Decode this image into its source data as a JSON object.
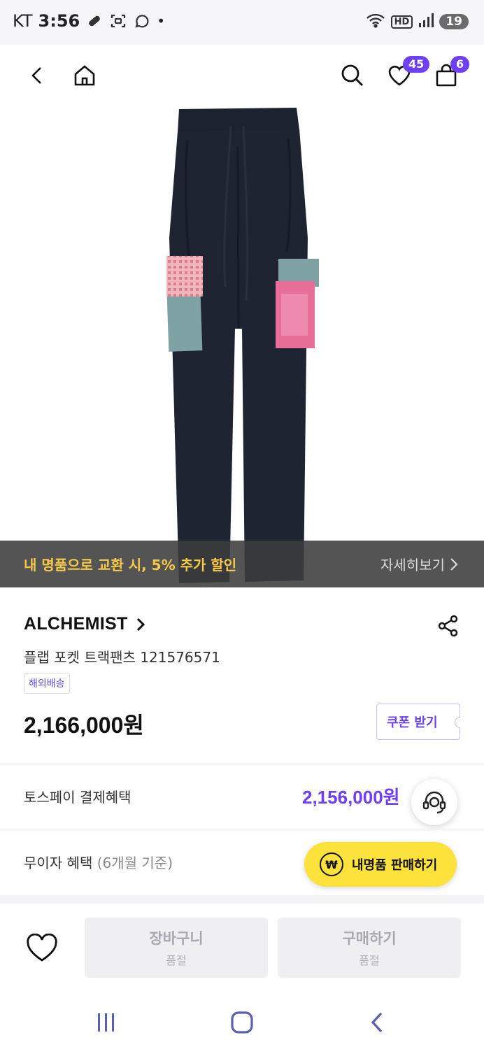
{
  "status_bar": {
    "carrier": "KT",
    "time": "3:56",
    "dot": "•",
    "hd": "HD",
    "battery": "19"
  },
  "nav": {
    "wishlist_count": "45",
    "cart_count": "6"
  },
  "promo": {
    "text": "내 명품으로 교환 시, 5% 추가 할인",
    "more": "자세히보기"
  },
  "product": {
    "brand": "ALCHEMIST",
    "name": "플랩 포켓 트랙팬츠 121576571",
    "tag": "해외배송",
    "price": "2,166,000원",
    "coupon_label": "쿠폰 받기"
  },
  "benefits": {
    "toss_label": "토스페이 결제혜택",
    "toss_price": "2,156,000원",
    "interest_label": "무이자 혜택",
    "interest_note": "(6개월 기준)"
  },
  "sell_button": {
    "icon_text": "₩",
    "label": "내명품 판매하기"
  },
  "actions": {
    "cart_label": "장바구니",
    "cart_status": "품절",
    "buy_label": "구매하기",
    "buy_status": "품절"
  },
  "colors": {
    "accent": "#6d3ff6",
    "promo_text": "#f7c948",
    "sell_button": "#fde23c"
  }
}
